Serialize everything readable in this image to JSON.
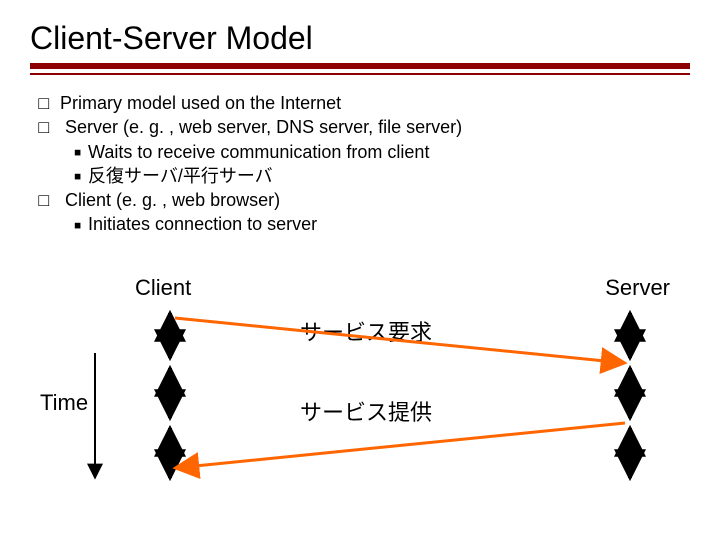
{
  "title": "Client-Server Model",
  "bullets": {
    "b1": "Primary model used on the Internet",
    "b2": "Server (e. g. , web server, DNS server, file server)",
    "b2_sub1": "Waits to receive communication from client",
    "b2_sub2": "反復サーバ/平行サーバ",
    "b3": "Client (e. g. , web browser)",
    "b3_sub1": "Initiates connection to server"
  },
  "diagram": {
    "client_label": "Client",
    "server_label": "Server",
    "time_label": "Time",
    "request_label": "サービス要求",
    "response_label": "サービス提供"
  },
  "colors": {
    "accent": "#8b0000",
    "arrow": "#ff6600"
  }
}
